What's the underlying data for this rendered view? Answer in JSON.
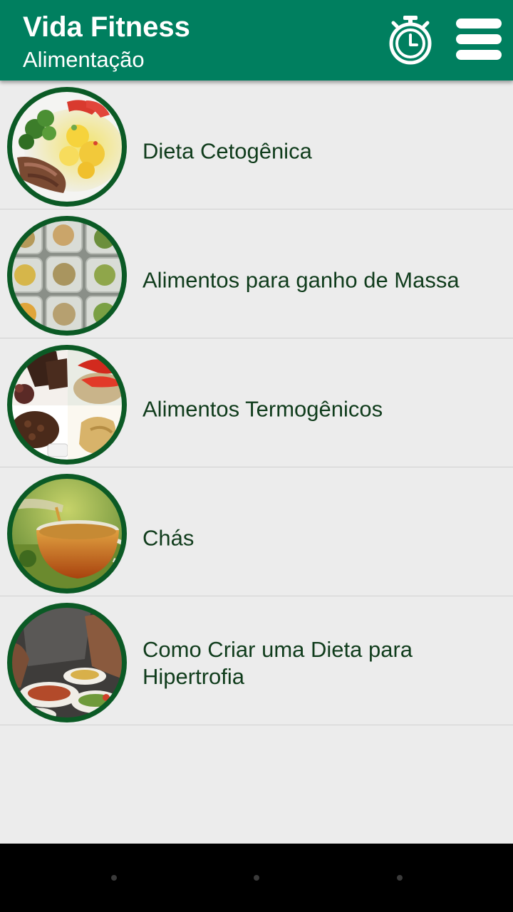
{
  "app_bar": {
    "title": "Vida Fitness",
    "subtitle": "Alimentação",
    "accent_color": "#007f5f",
    "actions": [
      "stopwatch-icon",
      "hamburger-menu-icon"
    ]
  },
  "list": {
    "items": [
      {
        "label": "Dieta Cetogênica",
        "image": "ketogenic-food-plate-image"
      },
      {
        "label": "Alimentos para ganho de Massa",
        "image": "meal-prep-containers-image"
      },
      {
        "label": "Alimentos Termogênicos",
        "image": "thermogenic-foods-collage-image"
      },
      {
        "label": "Chás",
        "image": "tea-cup-image"
      },
      {
        "label": "Como Criar uma Dieta para Hipertrofia",
        "image": "hypertrophy-diet-image"
      }
    ]
  },
  "nav_bar": {
    "buttons": [
      "back-nav-button",
      "home-nav-button",
      "recents-nav-button"
    ]
  }
}
